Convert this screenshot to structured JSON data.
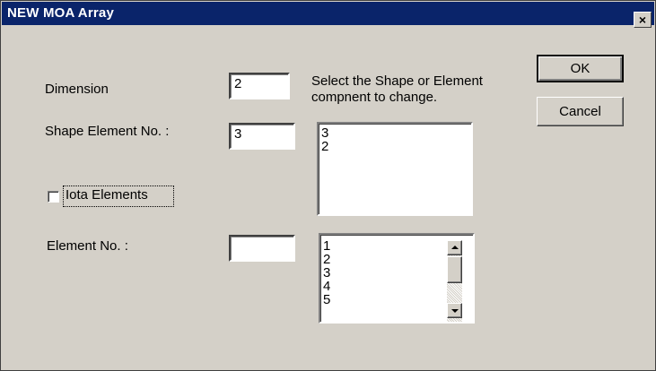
{
  "window": {
    "title": "NEW MOA Array",
    "close_glyph": "×"
  },
  "labels": {
    "dimension": "Dimension",
    "shape_element_no": "Shape Element No. :",
    "element_no": "Element No. :",
    "select_hint_line1": "Select the Shape or Element",
    "select_hint_line2": "compnent to change.",
    "iota_elements": "Iota Elements"
  },
  "fields": {
    "dimension": "2",
    "shape_element_no": "3",
    "element_no": ""
  },
  "buttons": {
    "ok": "OK",
    "cancel": "Cancel"
  },
  "shape_list": [
    "3",
    "2"
  ],
  "element_list": [
    "1",
    "2",
    "3",
    "4",
    "5"
  ],
  "iota_checked": false
}
